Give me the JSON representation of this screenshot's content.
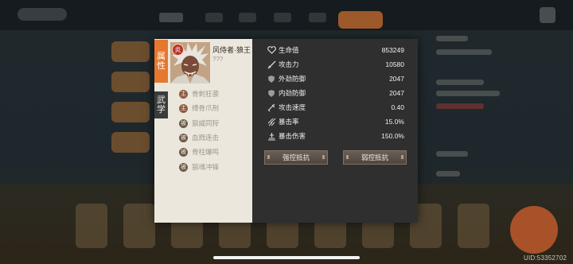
{
  "character": {
    "name": "风侍者·狼王",
    "subtitle": "???",
    "element_badge": "炎",
    "portrait": "character-portrait"
  },
  "tabs": [
    {
      "label_top": "属",
      "label_bottom": "性",
      "active": true
    },
    {
      "label_top": "武",
      "label_bottom": "学",
      "active": false
    }
  ],
  "skills": [
    {
      "type": "主",
      "name": "骨刺狂袭"
    },
    {
      "type": "主",
      "name": "缚骨爪刑"
    },
    {
      "type": "被",
      "name": "狼威同狩"
    },
    {
      "type": "被",
      "name": "血戮连击"
    },
    {
      "type": "被",
      "name": "骨柱爆鸣"
    },
    {
      "type": "被",
      "name": "狼魂冲锋"
    }
  ],
  "stats": [
    {
      "icon": "heart-icon",
      "label": "生命值",
      "value": "853249"
    },
    {
      "icon": "sword-icon",
      "label": "攻击力",
      "value": "10580"
    },
    {
      "icon": "shield-icon",
      "label": "外劲防御",
      "value": "2047"
    },
    {
      "icon": "shield-icon",
      "label": "内劲防御",
      "value": "2047"
    },
    {
      "icon": "speed-icon",
      "label": "攻击速度",
      "value": "0.40"
    },
    {
      "icon": "crit-icon",
      "label": "暴击率",
      "value": "15.0%"
    },
    {
      "icon": "crit-damage-icon",
      "label": "暴击伤害",
      "value": "150.0%"
    }
  ],
  "buttons": {
    "strong_resist": "强控抵抗",
    "weak_resist": "弱控抵抗"
  },
  "uid": "UID:53352702",
  "colors": {
    "accent": "#e5782e",
    "panel": "#2f2f2f",
    "card": "#ece7dd"
  }
}
